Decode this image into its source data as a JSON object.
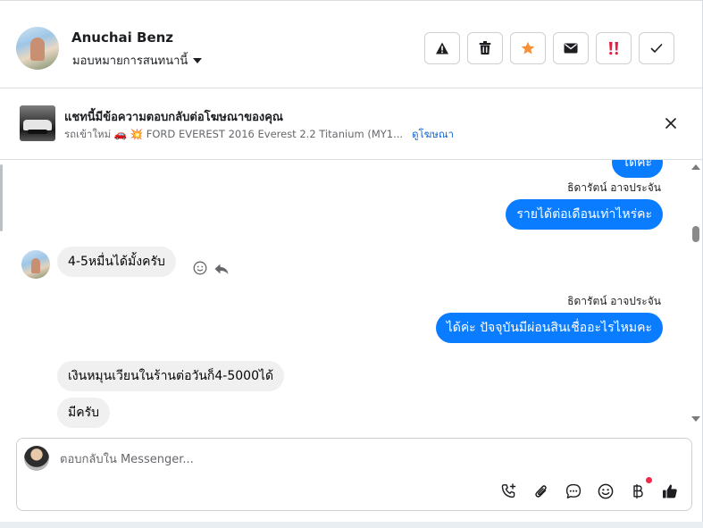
{
  "header": {
    "contact_name": "Anuchai Benz",
    "assign_label": "มอบหมายการสนทนานี้",
    "actions": [
      {
        "name": "report-icon"
      },
      {
        "name": "trash-icon"
      },
      {
        "name": "star-icon",
        "color": "#f7923b"
      },
      {
        "name": "mail-icon"
      },
      {
        "name": "urgent-icon",
        "color": "#e41e3f"
      },
      {
        "name": "check-icon"
      }
    ]
  },
  "ad_banner": {
    "title": "แชทนี้มีข้อความตอบกลับต่อโฆษณาของคุณ",
    "subtitle": "รถเข้าใหม่ 🚗 💥 FORD EVEREST 2016 Everest 2.2 Titanium (MY1...",
    "link_label": "ดูโฆษณา"
  },
  "messages": [
    {
      "direction": "out",
      "text": "ได้ค่ะ"
    },
    {
      "direction": "out",
      "sender": "ธิดารัตน์ อาจประจัน",
      "text": "รายได้ต่อเดือนเท่าไหร่คะ"
    },
    {
      "direction": "in",
      "text": "4-5หมื่นได้มั้งครับ"
    },
    {
      "direction": "out",
      "sender": "ธิดารัตน์ อาจประจัน",
      "text": "ได้ค่ะ ปัจจุบันมีผ่อนสินเชื่ออะไรไหมคะ"
    },
    {
      "direction": "in",
      "text": "เงินหมุนเวียนในร้านต่อวันก็4-5000ได้"
    },
    {
      "direction": "in",
      "text": "มีครับ"
    }
  ],
  "composer": {
    "placeholder": "ตอบกลับใน Messenger...",
    "tools": [
      "call-add-icon",
      "paperclip-icon",
      "chat-bubble-icon",
      "emoji-icon",
      "baht-icon",
      "thumbs-up-icon"
    ]
  },
  "colors": {
    "outgoing_bubble": "#0a7cff",
    "incoming_bubble": "#f0f0f0",
    "link": "#1766d3"
  }
}
